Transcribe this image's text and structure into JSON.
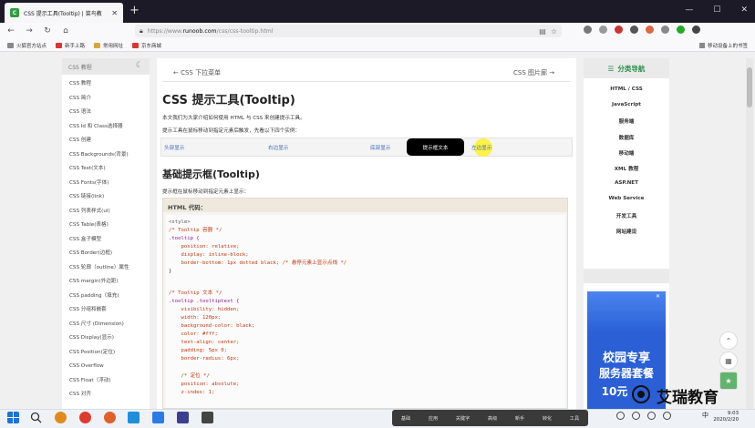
{
  "browser": {
    "tab_title": "CSS 提示工具(Tooltip) | 菜鸟教",
    "tab_favicon": "C",
    "url_prefix": "https://www.",
    "url_domain": "runoob.com",
    "url_path": "/css/css-tooltip.html",
    "bookmarks": [
      "火狐官方站点",
      "新手上路",
      "常用网址",
      "京东商城"
    ],
    "mobile_bookmarks": "移动设备上的书签"
  },
  "sidebar": {
    "header": "CSS 教程",
    "items": [
      "CSS 教程",
      "CSS 简介",
      "CSS 语法",
      "CSS Id 和 Class选择器",
      "CSS 创建",
      "CSS Backgrounds(背景)",
      "CSS Text(文本)",
      "CSS Fonts(字体)",
      "CSS 链接(link)",
      "CSS 列表样式(ul)",
      "CSS Table(表格)",
      "CSS 盒子模型",
      "CSS Border(边框)",
      "CSS 轮廓（outline）属性",
      "CSS margin(外边距)",
      "CSS padding（填充)",
      "CSS 分组和嵌套",
      "CSS 尺寸 (Dimension)",
      "CSS Display(显示)",
      "CSS Position(定位)",
      "CSS Overflow",
      "CSS Float（浮动)",
      "CSS 对齐"
    ]
  },
  "content": {
    "prev": "CSS 下拉菜单",
    "next": "CSS 图片廊",
    "title": "CSS 提示工具(Tooltip)",
    "intro1": "本文我们为大家介绍如何使用 HTML 与 CSS 来创建提示工具。",
    "intro2": "提示工具在鼠标移动到指定元素后触发，先看以下四个实例：",
    "demos": [
      "头部显示",
      "右边显示",
      "底部显示",
      "左边显示"
    ],
    "tooltip_text": "提示框文本",
    "subtitle": "基础提示框(Tooltip)",
    "subtitle_desc": "提示框在鼠标移动到指定元素上显示：",
    "code_header": "HTML 代码：",
    "code": {
      "l1": "<style>",
      "l2": "/* Tooltip 容器 */",
      "l3": ".tooltip {",
      "l4": "    position: relative;",
      "l5": "    display: inline-block;",
      "l6": "    border-bottom: 1px dotted black; /* 悬停元素上显示点线 */",
      "l7": "}",
      "l8": "/* Tooltip 文本 */",
      "l9": ".tooltip .tooltiptext {",
      "l10": "    visibility: hidden;",
      "l11": "    width: 120px;",
      "l12": "    background-color: black;",
      "l13": "    color: #fff;",
      "l14": "    text-align: center;",
      "l15": "    padding: 5px 0;",
      "l16": "    border-radius: 6px;",
      "l17": "    /* 定位 */",
      "l18": "    position: absolute;",
      "l19": "    z-index: 1;"
    }
  },
  "rightbar": {
    "header": "分类导航",
    "items": [
      "HTML / CSS",
      "JavaScript",
      "服务端",
      "数据库",
      "移动端",
      "XML 教程",
      "ASP.NET",
      "Web Service",
      "开发工具",
      "网站建设"
    ]
  },
  "ad": {
    "line1": "校园专享",
    "line2": "服务器套餐",
    "line3": "10元"
  },
  "watermark": "艾瑞教育",
  "taskbar": {
    "tray_items": [
      "基础",
      "应用",
      "关键字",
      "高级",
      "新手",
      "转化",
      "工具"
    ],
    "time": "9:03",
    "date": "2020/2/20",
    "ime": "中"
  },
  "colors": {
    "accent_green": "#2d8f49",
    "link_blue": "#3b6db6",
    "tooltip_bg": "#000000"
  }
}
